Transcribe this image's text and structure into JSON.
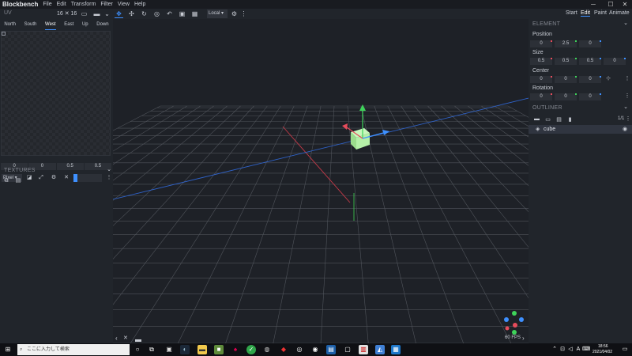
{
  "titlebar": {
    "app_name": "Blockbench",
    "menu": [
      "File",
      "Edit",
      "Transform",
      "Filter",
      "View",
      "Help"
    ],
    "minimize": "─",
    "maximize": "☐",
    "close": "✕"
  },
  "toolbar": {
    "uv_label": "UV",
    "uv_size": "16 ✕ 16",
    "transform_space": "Local ▾",
    "modes": [
      "Start",
      "Edit",
      "Paint",
      "Animate"
    ],
    "active_mode": "Edit"
  },
  "uv": {
    "faces": [
      "North",
      "South",
      "West",
      "East",
      "Up",
      "Down"
    ],
    "active_face": "West",
    "values": [
      "0",
      "0",
      "0.5",
      "0.5"
    ],
    "snap_select": "Pixel ▾"
  },
  "textures": {
    "heading": "TEXTURES"
  },
  "element": {
    "heading": "ELEMENT",
    "position_label": "Position",
    "position": [
      "0",
      "2.5",
      "0"
    ],
    "size_label": "Size",
    "size": [
      "0.5",
      "0.5",
      "0.5",
      "0"
    ],
    "center_label": "Center",
    "center": [
      "0",
      "0",
      "0"
    ],
    "rotation_label": "Rotation",
    "rotation": [
      "0",
      "0",
      "0"
    ]
  },
  "outliner": {
    "heading": "OUTLINER",
    "count": "1/1",
    "items": [
      {
        "name": "cube"
      }
    ]
  },
  "viewport": {
    "fps": "60 FPS"
  },
  "taskbar": {
    "search_placeholder": "ここに入力して検索",
    "time": "18:56",
    "date": "2021/04/02"
  },
  "colors": {
    "accent": "#3e90ff",
    "x_axis": "#e74c5c",
    "y_axis": "#3ed35a",
    "z_axis": "#3e90ff",
    "cube": "#b5f0a8"
  }
}
